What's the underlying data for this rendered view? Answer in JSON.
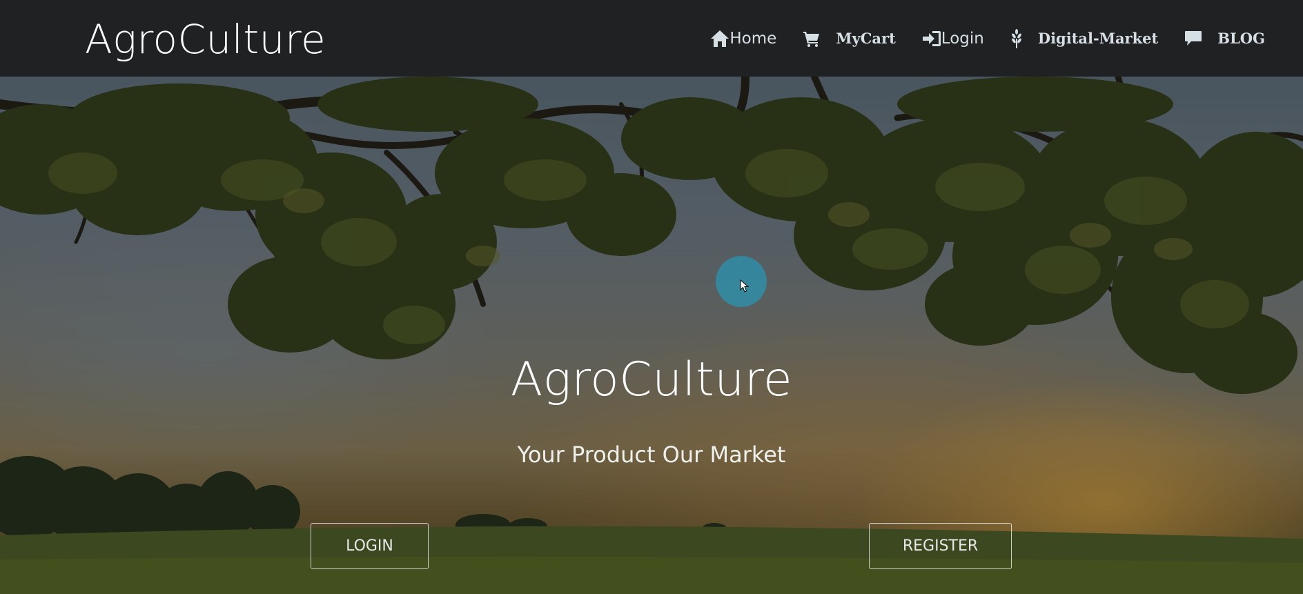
{
  "brand": "AgroCulture",
  "nav": {
    "home": {
      "label": "Home",
      "icon": "home-icon"
    },
    "cart": {
      "label": "MyCart",
      "icon": "cart-icon"
    },
    "login": {
      "label": "Login",
      "icon": "sign-in-icon"
    },
    "market": {
      "label": "Digital-Market",
      "icon": "grain-icon"
    },
    "blog": {
      "label": "BLOG",
      "icon": "comment-icon"
    }
  },
  "hero": {
    "title": "AgroCulture",
    "subtitle": "Your Product Our Market",
    "login_button": "LOGIN",
    "register_button": "REGISTER"
  },
  "colors": {
    "navbar_bg": "#1f2122",
    "nav_text": "#d6dfe4",
    "cursor_halo": "#2896b4"
  }
}
